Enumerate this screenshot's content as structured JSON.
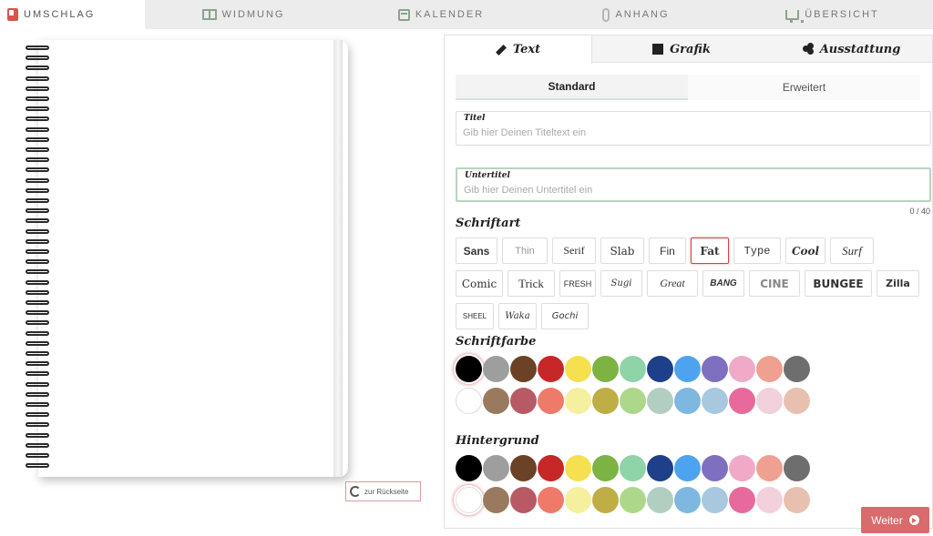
{
  "topnav": {
    "tabs": [
      {
        "label": "UMSCHLAG",
        "icon": "cover-icon",
        "active": true
      },
      {
        "label": "WIDMUNG",
        "icon": "book-open-icon",
        "active": false
      },
      {
        "label": "KALENDER",
        "icon": "calendar-icon",
        "active": false
      },
      {
        "label": "ANHANG",
        "icon": "paperclip-icon",
        "active": false
      },
      {
        "label": "ÜBERSICHT",
        "icon": "cart-icon",
        "active": false
      }
    ]
  },
  "notebook": {
    "back_button_label": "zur Rückseite"
  },
  "panel": {
    "tabs": [
      {
        "label": "Text",
        "icon": "pencil-icon",
        "active": true
      },
      {
        "label": "Grafik",
        "icon": "image-icon",
        "active": false
      },
      {
        "label": "Ausstattung",
        "icon": "clover-icon",
        "active": false
      }
    ],
    "subtabs": [
      {
        "label": "Standard",
        "active": true
      },
      {
        "label": "Erweitert",
        "active": false
      }
    ],
    "title_field": {
      "label": "Titel",
      "placeholder": "Gib hier Deinen Titeltext ein"
    },
    "subtitle_field": {
      "label": "Untertitel",
      "placeholder": "Gib hier Deinen Untertitel ein",
      "counter": "0 / 40"
    },
    "font_section_title": "Schriftart",
    "fonts": [
      [
        "Sans",
        "Thin",
        "Serif",
        "Slab",
        "Fin",
        "Fat",
        "Type",
        "Cool",
        "Surf"
      ],
      [
        "Comic",
        "Trick",
        "FRESH",
        "Sugi",
        "Great",
        "BANG",
        "CINE",
        "BUNGEE",
        "Zilla"
      ],
      [
        "SHEEL",
        "Waka",
        "Gochi"
      ]
    ],
    "selected_font": "Fat",
    "font_color_title": "Schriftfarbe",
    "background_title": "Hintergrund",
    "colors_row1": [
      "#000000",
      "#9e9e9e",
      "#6b4226",
      "#c62828",
      "#f5e050",
      "#7cb342",
      "#8fd3a8",
      "#1e3f8a",
      "#4da3f0",
      "#7e6fc0",
      "#f0aac8",
      "#f0a090",
      "#6e6e6e"
    ],
    "colors_row2": [
      "#ffffff",
      "#9a7a5e",
      "#b85a66",
      "#ee7a6a",
      "#f5f0a0",
      "#bfae46",
      "#add88a",
      "#b0cfc0",
      "#7eb8e0",
      "#a8c8e0",
      "#e86a9c",
      "#f2d0dc",
      "#e8c0b0"
    ],
    "selected_font_color": "#000000",
    "selected_background_color": "#ffffff",
    "next_button_label": "Weiter"
  }
}
